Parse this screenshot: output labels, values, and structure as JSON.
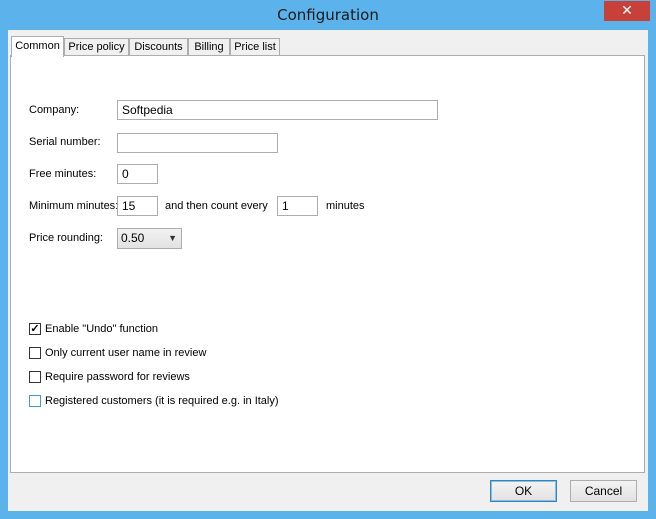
{
  "window": {
    "title": "Configuration",
    "close_glyph": "✕"
  },
  "tabs": [
    {
      "label": "Common",
      "active": true
    },
    {
      "label": "Price policy",
      "active": false
    },
    {
      "label": "Discounts",
      "active": false
    },
    {
      "label": "Billing",
      "active": false
    },
    {
      "label": "Price list",
      "active": false
    }
  ],
  "form": {
    "company_label": "Company:",
    "company_value": "Softpedia",
    "serial_label": "Serial number:",
    "serial_value": "",
    "free_minutes_label": "Free minutes:",
    "free_minutes_value": "0",
    "minimum_minutes_label": "Minimum minutes:",
    "minimum_minutes_value": "15",
    "then_count_label": "and then count every",
    "count_every_value": "1",
    "minutes_label": "minutes",
    "price_rounding_label": "Price rounding:",
    "price_rounding_value": "0.50"
  },
  "checkboxes": [
    {
      "label": "Enable \"Undo\" function",
      "checked": true
    },
    {
      "label": "Only current user name in review",
      "checked": false
    },
    {
      "label": "Require password for reviews",
      "checked": false
    },
    {
      "label": "Registered customers (it is required e.g. in Italy)",
      "checked": false
    }
  ],
  "buttons": {
    "ok": "OK",
    "cancel": "Cancel"
  },
  "icons": {
    "close": "close-icon",
    "dropdown": "chevron-down-icon",
    "check": "check-icon"
  },
  "colors": {
    "titlebar": "#5cb3eb",
    "close_button": "#c7403a",
    "dialog_bg": "#f0f0f0"
  }
}
